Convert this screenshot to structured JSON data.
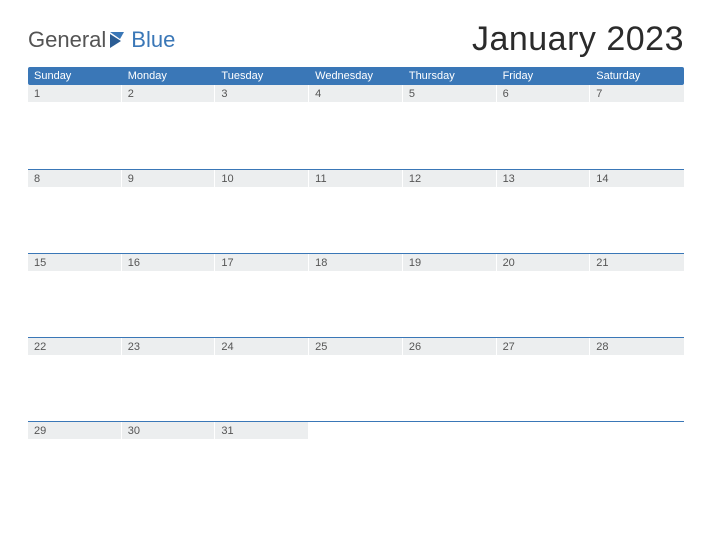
{
  "logo": {
    "part1": "General",
    "part2": "Blue"
  },
  "title": "January 2023",
  "daynames": [
    "Sunday",
    "Monday",
    "Tuesday",
    "Wednesday",
    "Thursday",
    "Friday",
    "Saturday"
  ],
  "weeks": [
    [
      "1",
      "2",
      "3",
      "4",
      "5",
      "6",
      "7"
    ],
    [
      "8",
      "9",
      "10",
      "11",
      "12",
      "13",
      "14"
    ],
    [
      "15",
      "16",
      "17",
      "18",
      "19",
      "20",
      "21"
    ],
    [
      "22",
      "23",
      "24",
      "25",
      "26",
      "27",
      "28"
    ],
    [
      "29",
      "30",
      "31",
      "",
      "",
      "",
      ""
    ]
  ]
}
